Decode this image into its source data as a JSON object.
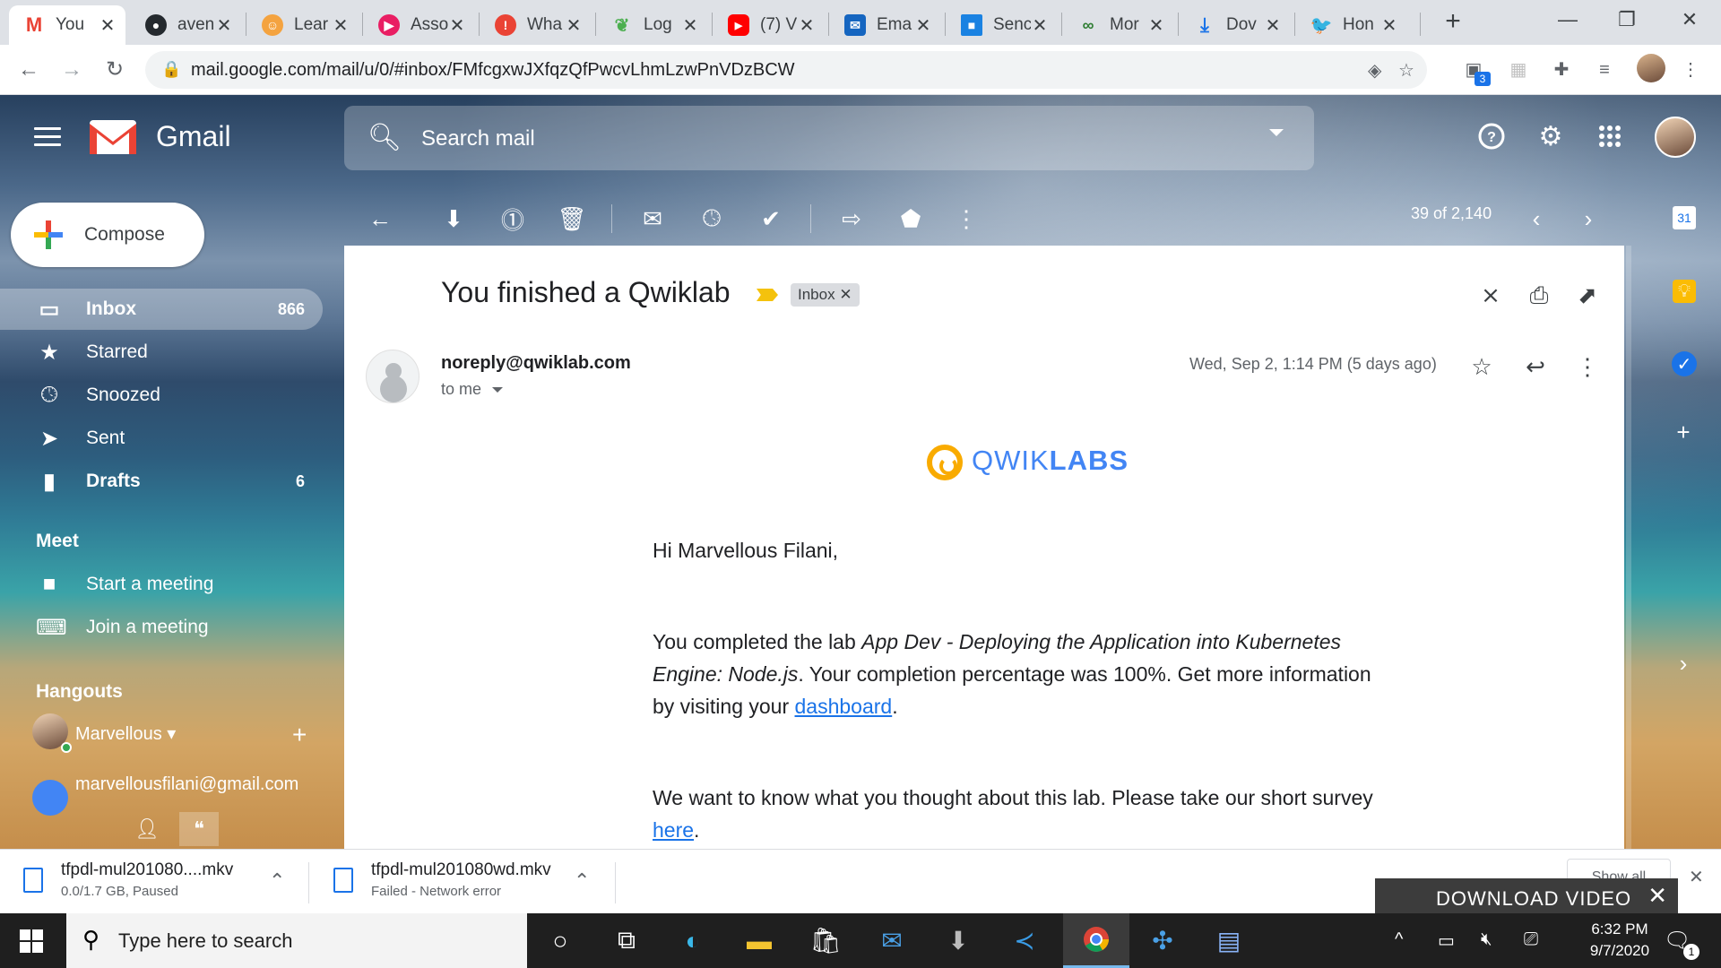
{
  "browser": {
    "tabs": [
      {
        "title": "You",
        "icon": "gmail-icon",
        "color": "#ea4335",
        "active": true
      },
      {
        "title": "aven",
        "icon": "github-icon",
        "color": "#24292e"
      },
      {
        "title": "Lear",
        "icon": "learn-icon",
        "color": "#f4a340"
      },
      {
        "title": "Asso",
        "icon": "assoc-icon",
        "color": "#e91e63"
      },
      {
        "title": "Wha",
        "icon": "alert-icon",
        "color": "#ea4335"
      },
      {
        "title": "Log",
        "icon": "mongodb-leaf-icon",
        "color": "#4caf50"
      },
      {
        "title": "(7) V",
        "icon": "youtube-icon",
        "color": "#ff0000"
      },
      {
        "title": "Ema",
        "icon": "email-template-icon",
        "color": "#1565c0"
      },
      {
        "title": "Senc",
        "icon": "sendgrid-icon",
        "color": "#1a82e2"
      },
      {
        "title": "Mor",
        "icon": "link-icon",
        "color": "#2e7d32"
      },
      {
        "title": "Dov",
        "icon": "download-icon",
        "color": "#1a73e8"
      },
      {
        "title": "Hon",
        "icon": "twitter-icon",
        "color": "#1da1f2"
      }
    ],
    "url": "mail.google.com/mail/u/0/#inbox/FMfcgxwJXfqzQfPwcvLhmLzwPnVDzBCW",
    "extension_badge": "3"
  },
  "gmail": {
    "app_name": "Gmail",
    "search_placeholder": "Search mail",
    "compose_label": "Compose",
    "nav": [
      {
        "label": "Inbox",
        "count": "866",
        "icon": "inbox-icon",
        "active": true
      },
      {
        "label": "Starred",
        "count": "",
        "icon": "star-icon"
      },
      {
        "label": "Snoozed",
        "count": "",
        "icon": "clock-icon"
      },
      {
        "label": "Sent",
        "count": "",
        "icon": "send-icon"
      },
      {
        "label": "Drafts",
        "count": "6",
        "icon": "draft-icon"
      }
    ],
    "meet": {
      "title": "Meet",
      "items": [
        {
          "label": "Start a meeting",
          "icon": "video-camera-icon"
        },
        {
          "label": "Join a meeting",
          "icon": "keyboard-icon"
        }
      ]
    },
    "hangouts": {
      "title": "Hangouts",
      "user": "Marvellous",
      "contact": "marvellousfilani@gmail.com"
    },
    "pager": "39 of 2,140"
  },
  "email": {
    "subject": "You finished a Qwiklab",
    "label": "Inbox",
    "sender": "noreply@qwiklab.com",
    "recipient": "to me",
    "date": "Wed, Sep 2, 1:14 PM (5 days ago)",
    "logo_light": "QWIK",
    "logo_bold": "LABS",
    "greeting": "Hi Marvellous Filani,",
    "p1_a": "You completed the lab ",
    "p1_lab": "App Dev - Deploying the Application into Kubernetes Engine: Node.js",
    "p1_b": ". Your completion percentage was 100%. Get more information by visiting your ",
    "p1_link": "dashboard",
    "p1_end": ".",
    "p2_a": "We want to know what you thought about this lab. Please take our short survey ",
    "p2_link": "here",
    "p2_end": "."
  },
  "downloads": [
    {
      "name": "tfpdl-mul201080....mkv",
      "status": "0.0/1.7 GB, Paused"
    },
    {
      "name": "tfpdl-mul201080wd.mkv",
      "status": "Failed - Network error"
    }
  ],
  "download_overlay": "DOWNLOAD VIDEO",
  "show_all": "Show all",
  "taskbar": {
    "search_placeholder": "Type here to search",
    "time": "6:32 PM",
    "date": "9/7/2020",
    "notification_count": "1"
  }
}
